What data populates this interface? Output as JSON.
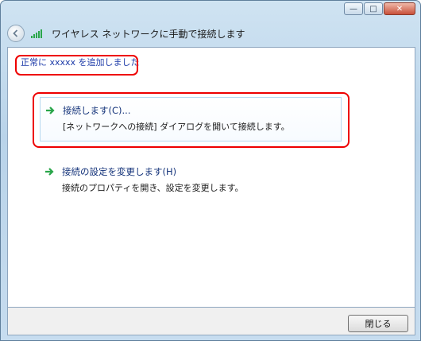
{
  "window": {
    "title": "ワイヤレス ネットワークに手動で接続します"
  },
  "caption_buttons": {
    "minimize_icon": "minimize-icon",
    "maximize_icon": "maximize-icon",
    "close_icon": "close-icon"
  },
  "main": {
    "success_message": "正常に xxxxx を追加しました",
    "options": [
      {
        "title": "接続します(C)...",
        "description": "[ネットワークへの接続] ダイアログを開いて接続します。"
      },
      {
        "title": "接続の設定を変更します(H)",
        "description": "接続のプロパティを開き、設定を変更します。"
      }
    ]
  },
  "footer": {
    "close_label": "閉じる"
  },
  "colors": {
    "highlight_box": "#e00000",
    "link_text": "#14337a",
    "arrow_green": "#2aa64a"
  }
}
